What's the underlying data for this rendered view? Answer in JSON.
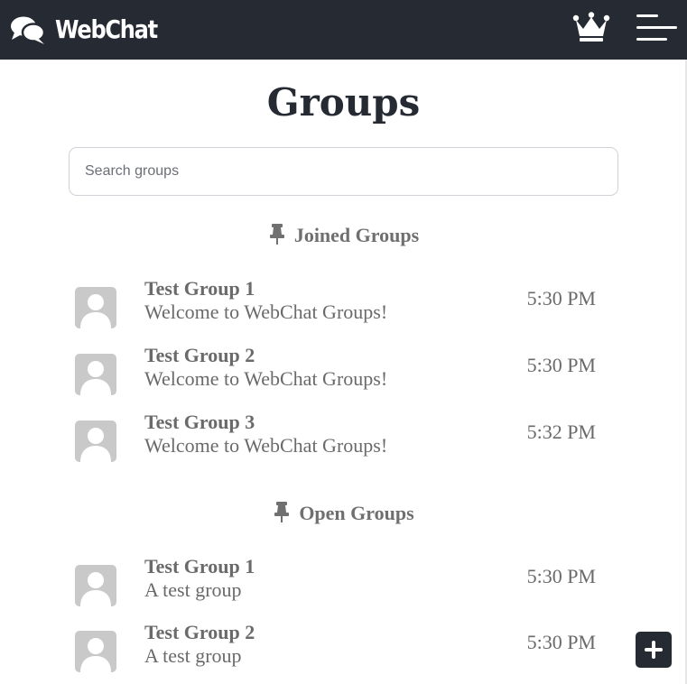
{
  "header": {
    "brand": "WebChat",
    "brand_icon": "chat-bubbles-icon",
    "crown_icon": "crown-icon",
    "menu_icon": "hamburger-menu-icon",
    "background": "#252a33"
  },
  "page": {
    "title": "Groups"
  },
  "search": {
    "placeholder": "Search groups",
    "value": ""
  },
  "sections": {
    "joined": {
      "heading": "Joined Groups",
      "icon": "pin-icon",
      "items": [
        {
          "name": "Test Group 1",
          "message": "Welcome to WebChat Groups!",
          "time": "5:30 PM",
          "avatar": "default-avatar-icon"
        },
        {
          "name": "Test Group 2",
          "message": "Welcome to WebChat Groups!",
          "time": "5:30 PM",
          "avatar": "default-avatar-icon"
        },
        {
          "name": "Test Group 3",
          "message": "Welcome to WebChat Groups!",
          "time": "5:32 PM",
          "avatar": "default-avatar-icon"
        }
      ]
    },
    "open": {
      "heading": "Open Groups",
      "icon": "pin-icon",
      "items": [
        {
          "name": "Test Group 1",
          "message": "A test group",
          "time": "5:30 PM",
          "avatar": "default-avatar-icon"
        },
        {
          "name": "Test Group 2",
          "message": "A test group",
          "time": "5:30 PM",
          "avatar": "default-avatar-icon"
        }
      ]
    }
  },
  "fab": {
    "icon": "plus-icon"
  },
  "colors": {
    "dark": "#252a33",
    "muted_text": "#6a6a6a",
    "avatar": "#c9c9c9"
  }
}
